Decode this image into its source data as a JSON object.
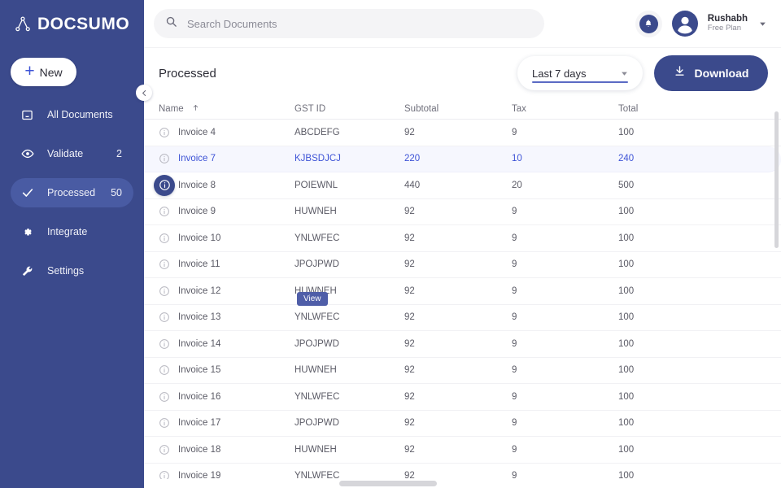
{
  "brand": {
    "name": "DOCSUMO",
    "logo_icon": "node-graph-icon",
    "sidebar_color": "#3b4a8c",
    "accent_color": "#3d53d6"
  },
  "sidebar": {
    "new_button": {
      "label": "New",
      "icon": "plus-icon"
    },
    "collapse_icon": "chevron-left-icon",
    "items": [
      {
        "label": "All Documents",
        "icon": "inbox-icon",
        "count": "",
        "active": false
      },
      {
        "label": "Validate",
        "icon": "eye-icon",
        "count": "2",
        "active": false
      },
      {
        "label": "Processed",
        "icon": "check-icon",
        "count": "50",
        "active": true
      },
      {
        "label": "Integrate",
        "icon": "gear-icon",
        "count": "",
        "active": false
      },
      {
        "label": "Settings",
        "icon": "wrench-icon",
        "count": "",
        "active": false
      }
    ]
  },
  "topbar": {
    "search": {
      "placeholder": "Search Documents",
      "value": "",
      "icon": "search-icon"
    },
    "notification_icon": "bell-icon",
    "avatar_icon": "user-avatar-icon",
    "user_name": "Rushabh",
    "user_plan": "Free Plan",
    "caret_icon": "chevron-down-icon"
  },
  "toolbar": {
    "title": "Processed",
    "date_filter": {
      "value": "Last 7 days",
      "caret_icon": "chevron-down-icon"
    },
    "download": {
      "label": "Download",
      "icon": "download-icon"
    }
  },
  "table": {
    "columns": [
      {
        "label": "Name",
        "sort_icon": "arrow-up-icon"
      },
      {
        "label": "GST ID",
        "sort_icon": ""
      },
      {
        "label": "Subtotal",
        "sort_icon": ""
      },
      {
        "label": "Tax",
        "sort_icon": ""
      },
      {
        "label": "Total",
        "sort_icon": ""
      }
    ],
    "row_icon": "info-circle-icon",
    "tooltip": "View",
    "rows": [
      {
        "name": "Invoice 4",
        "gst": "ABCDEFG",
        "subtotal": "92",
        "tax": "9",
        "total": "100",
        "state": "normal"
      },
      {
        "name": "Invoice 7",
        "gst": "KJBSDJCJ",
        "subtotal": "220",
        "tax": "10",
        "total": "240",
        "state": "selected"
      },
      {
        "name": "Invoice 8",
        "gst": "POIEWNL",
        "subtotal": "440",
        "tax": "20",
        "total": "500",
        "state": "hovered"
      },
      {
        "name": "Invoice 9",
        "gst": "HUWNEH",
        "subtotal": "92",
        "tax": "9",
        "total": "100",
        "state": "normal"
      },
      {
        "name": "Invoice 10",
        "gst": "YNLWFEC",
        "subtotal": "92",
        "tax": "9",
        "total": "100",
        "state": "normal"
      },
      {
        "name": "Invoice 11",
        "gst": "JPOJPWD",
        "subtotal": "92",
        "tax": "9",
        "total": "100",
        "state": "normal"
      },
      {
        "name": "Invoice 12",
        "gst": "HUWNEH",
        "subtotal": "92",
        "tax": "9",
        "total": "100",
        "state": "normal"
      },
      {
        "name": "Invoice 13",
        "gst": "YNLWFEC",
        "subtotal": "92",
        "tax": "9",
        "total": "100",
        "state": "normal"
      },
      {
        "name": "Invoice 14",
        "gst": "JPOJPWD",
        "subtotal": "92",
        "tax": "9",
        "total": "100",
        "state": "normal"
      },
      {
        "name": "Invoice 15",
        "gst": "HUWNEH",
        "subtotal": "92",
        "tax": "9",
        "total": "100",
        "state": "normal"
      },
      {
        "name": "Invoice 16",
        "gst": "YNLWFEC",
        "subtotal": "92",
        "tax": "9",
        "total": "100",
        "state": "normal"
      },
      {
        "name": "Invoice 17",
        "gst": "JPOJPWD",
        "subtotal": "92",
        "tax": "9",
        "total": "100",
        "state": "normal"
      },
      {
        "name": "Invoice 18",
        "gst": "HUWNEH",
        "subtotal": "92",
        "tax": "9",
        "total": "100",
        "state": "normal"
      },
      {
        "name": "Invoice 19",
        "gst": "YNLWFEC",
        "subtotal": "92",
        "tax": "9",
        "total": "100",
        "state": "normal"
      }
    ]
  }
}
